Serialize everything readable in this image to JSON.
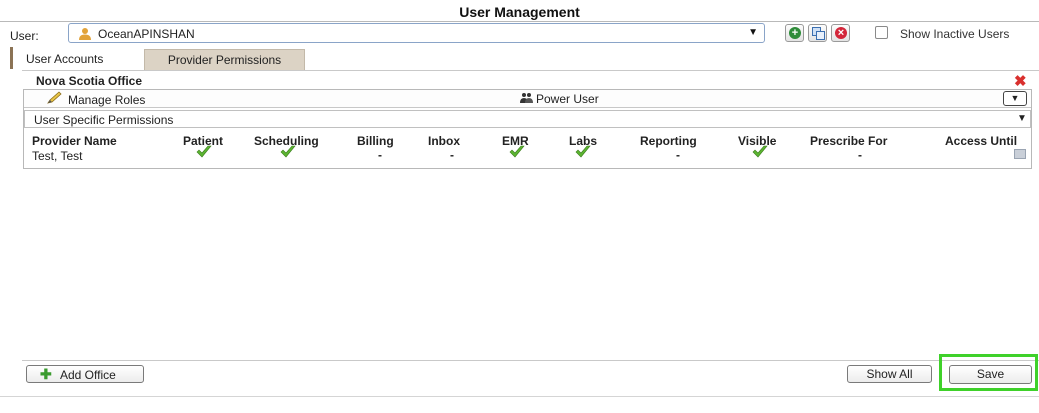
{
  "window": {
    "title": "User Management"
  },
  "user_row": {
    "label": "User:",
    "selected_user": "OceanAPINSHAN",
    "show_inactive_label": "Show Inactive Users",
    "show_inactive_checked": false
  },
  "tabs": [
    {
      "label": "User Accounts",
      "active": false
    },
    {
      "label": "Provider Permissions",
      "active": true
    }
  ],
  "office": {
    "name": "Nova Scotia Office",
    "manage_roles_label": "Manage Roles",
    "role_value": "Power User",
    "permissions_mode": "User Specific Permissions"
  },
  "table": {
    "columns": [
      "Provider Name",
      "Patient",
      "Scheduling",
      "Billing",
      "Inbox",
      "EMR",
      "Labs",
      "Reporting",
      "Visible",
      "Prescribe For",
      "Access Until"
    ],
    "rows": [
      {
        "provider": "Test, Test",
        "cells": [
          "check",
          "check",
          "-",
          "-",
          "check",
          "check",
          "-",
          "check",
          "-",
          "calendar"
        ]
      }
    ]
  },
  "footer": {
    "add_office_label": "Add Office",
    "show_all_label": "Show All",
    "save_label": "Save"
  },
  "colors": {
    "accent_green": "#3fd12a",
    "check_green": "#5cb531",
    "tab_active_bg": "#dcd3c5",
    "delete_red": "#d9302e"
  },
  "icons": {
    "user": "person-icon",
    "add": "add-user-icon",
    "copy": "copy-user-icon",
    "remove": "remove-user-icon",
    "delete_office": "close-icon",
    "manage_roles": "pencil-icon",
    "power_user": "group-icon",
    "access_until": "calendar-icon",
    "add_office": "plus-icon"
  }
}
